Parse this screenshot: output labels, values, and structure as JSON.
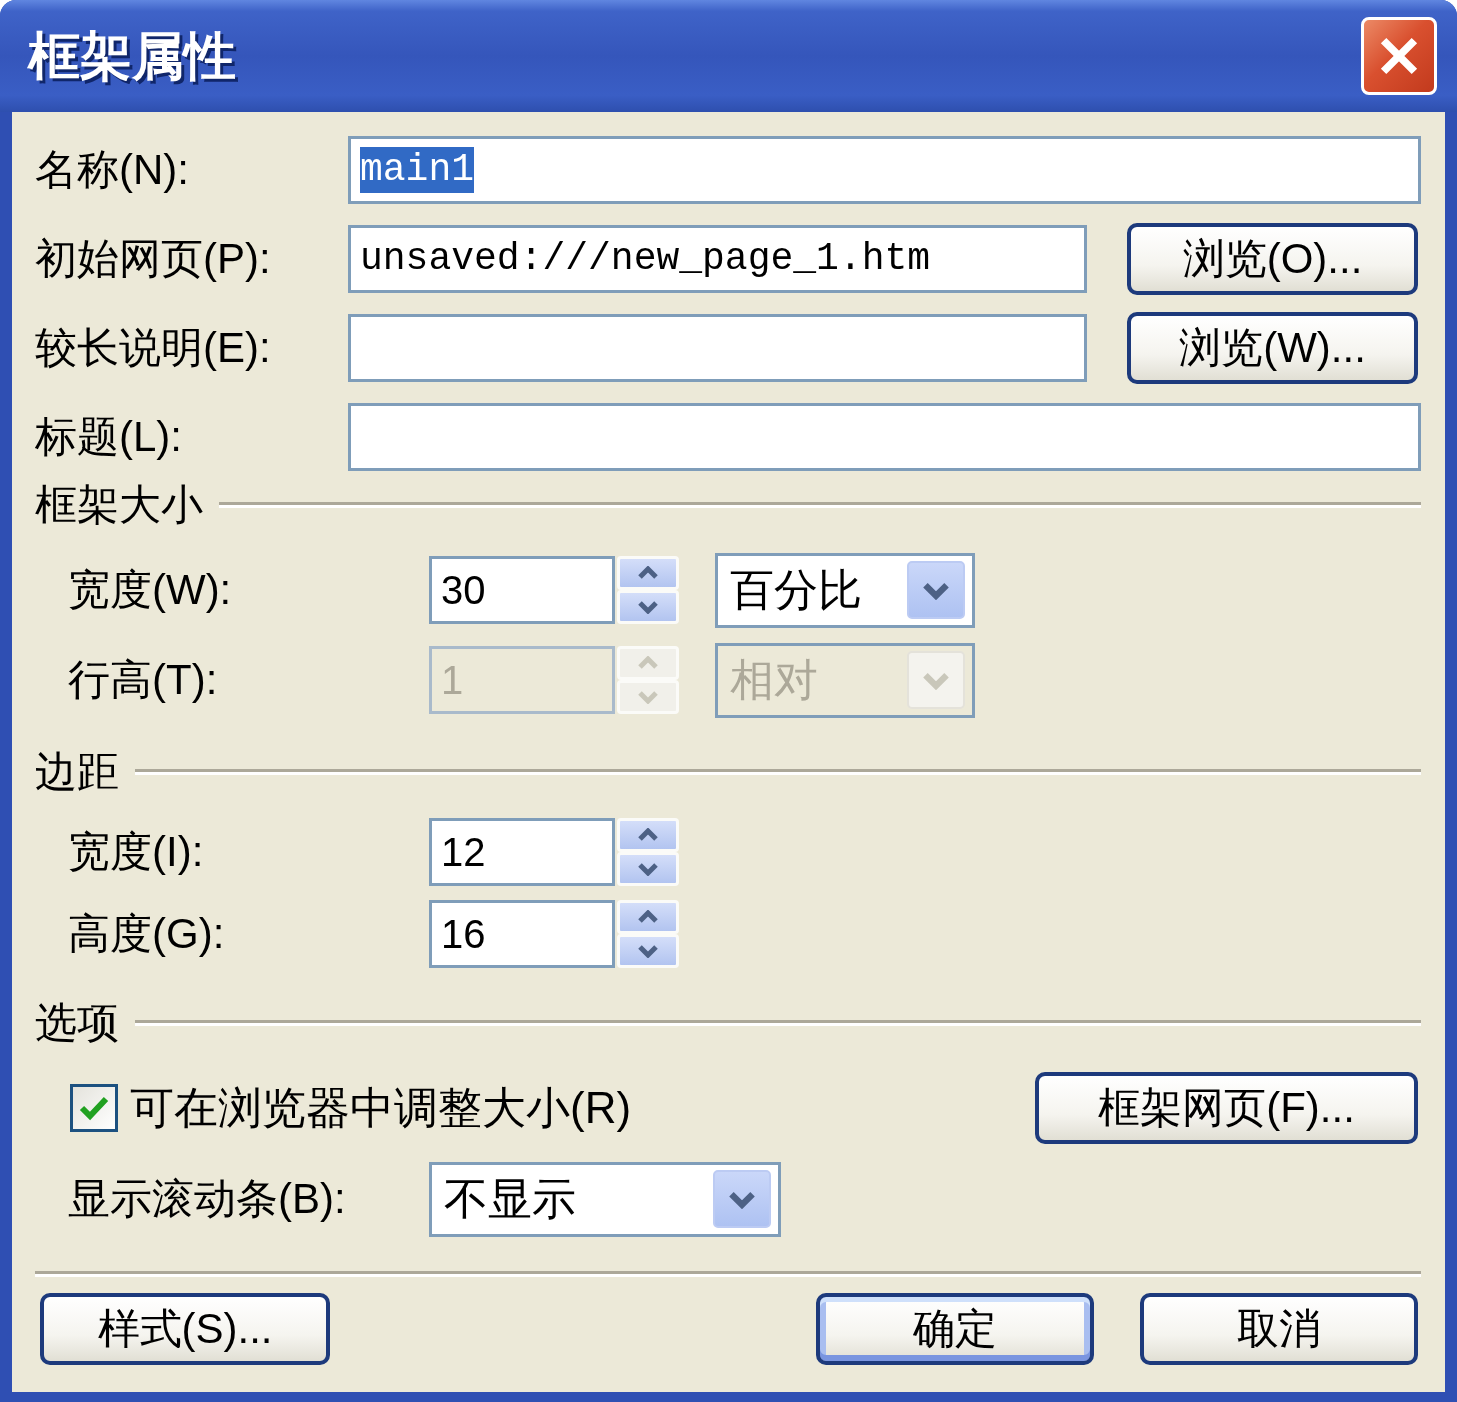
{
  "window": {
    "title": "框架属性"
  },
  "fields": [
    {
      "label": "名称(N):",
      "value": "main1",
      "text_selected": true
    },
    {
      "label": "初始网页(P):",
      "value": "unsaved:///new_page_1.htm",
      "text_selected": false,
      "button": "浏览(O)..."
    },
    {
      "label": "较长说明(E):",
      "button": "浏览(W)..."
    },
    {
      "label": "标题(L):"
    }
  ],
  "sections": [
    {
      "title": "框架大小",
      "rows": [
        {
          "kind": "spinner",
          "label": "宽度(W):",
          "value": "30",
          "disabled": false,
          "unit": {
            "value": "百分比",
            "disabled": false
          }
        },
        {
          "kind": "spinner",
          "label": "行高(T):",
          "value": "1",
          "disabled": true,
          "unit": {
            "value": "相对",
            "disabled": true
          }
        }
      ]
    },
    {
      "title": "边距",
      "rows": [
        {
          "kind": "spinner",
          "label": "宽度(I):",
          "value": "12",
          "disabled": false
        },
        {
          "kind": "spinner",
          "label": "高度(G):",
          "value": "16",
          "disabled": false
        }
      ]
    },
    {
      "title": "选项",
      "rows": [
        {
          "kind": "checkbox",
          "label": "可在浏览器中调整大小(R)",
          "checked": true,
          "button": "框架网页(F)..."
        },
        {
          "kind": "dropdown",
          "label": "显示滚动条(B):",
          "value": "不显示",
          "disabled": false
        }
      ]
    }
  ],
  "footer": {
    "left_buttons": [
      {
        "label": "样式(S)...",
        "default": false
      }
    ],
    "right_buttons": [
      {
        "label": "确定",
        "default": true
      },
      {
        "label": "取消",
        "default": false
      }
    ]
  }
}
